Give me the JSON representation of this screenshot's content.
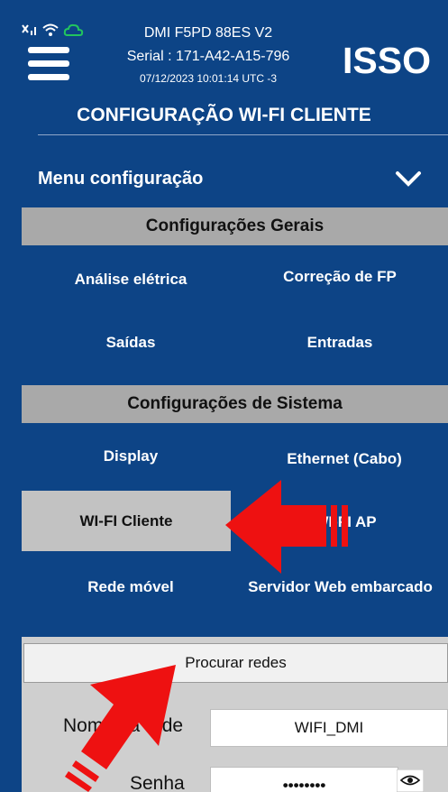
{
  "header": {
    "device_name": "DMI F5PD 88ES V2",
    "serial": "Serial : 171-A42-A15-796",
    "datetime": "07/12/2023 10:01:14 UTC -3",
    "logo_text": "ISSO",
    "status_icons": [
      "signal-off-icon",
      "wifi-icon",
      "cloud-icon"
    ]
  },
  "page": {
    "title": "CONFIGURAÇÃO WI-FI CLIENTE"
  },
  "menu": {
    "header_label": "Menu configuração",
    "sections": [
      {
        "title": "Configurações Gerais",
        "items": [
          "Análise elétrica",
          "Correção de FP",
          "Saídas",
          "Entradas"
        ]
      },
      {
        "title": "Configurações de Sistema",
        "items": [
          "Display",
          "Ethernet (Cabo)",
          "WI-FI Cliente",
          "WI-FI AP",
          "Rede móvel",
          "Servidor Web embarcado"
        ]
      }
    ],
    "active_item": "WI-FI Cliente"
  },
  "form": {
    "search_button": "Procurar redes",
    "network_label": "Nome da rede",
    "network_value": "WIFI_DMI",
    "password_label": "Senha",
    "password_value": "••••••••"
  },
  "colors": {
    "background": "#0d4486",
    "section_bar": "#a9a9a9",
    "active_item": "#c2c2c2",
    "annotation_arrow": "#ee1111"
  }
}
